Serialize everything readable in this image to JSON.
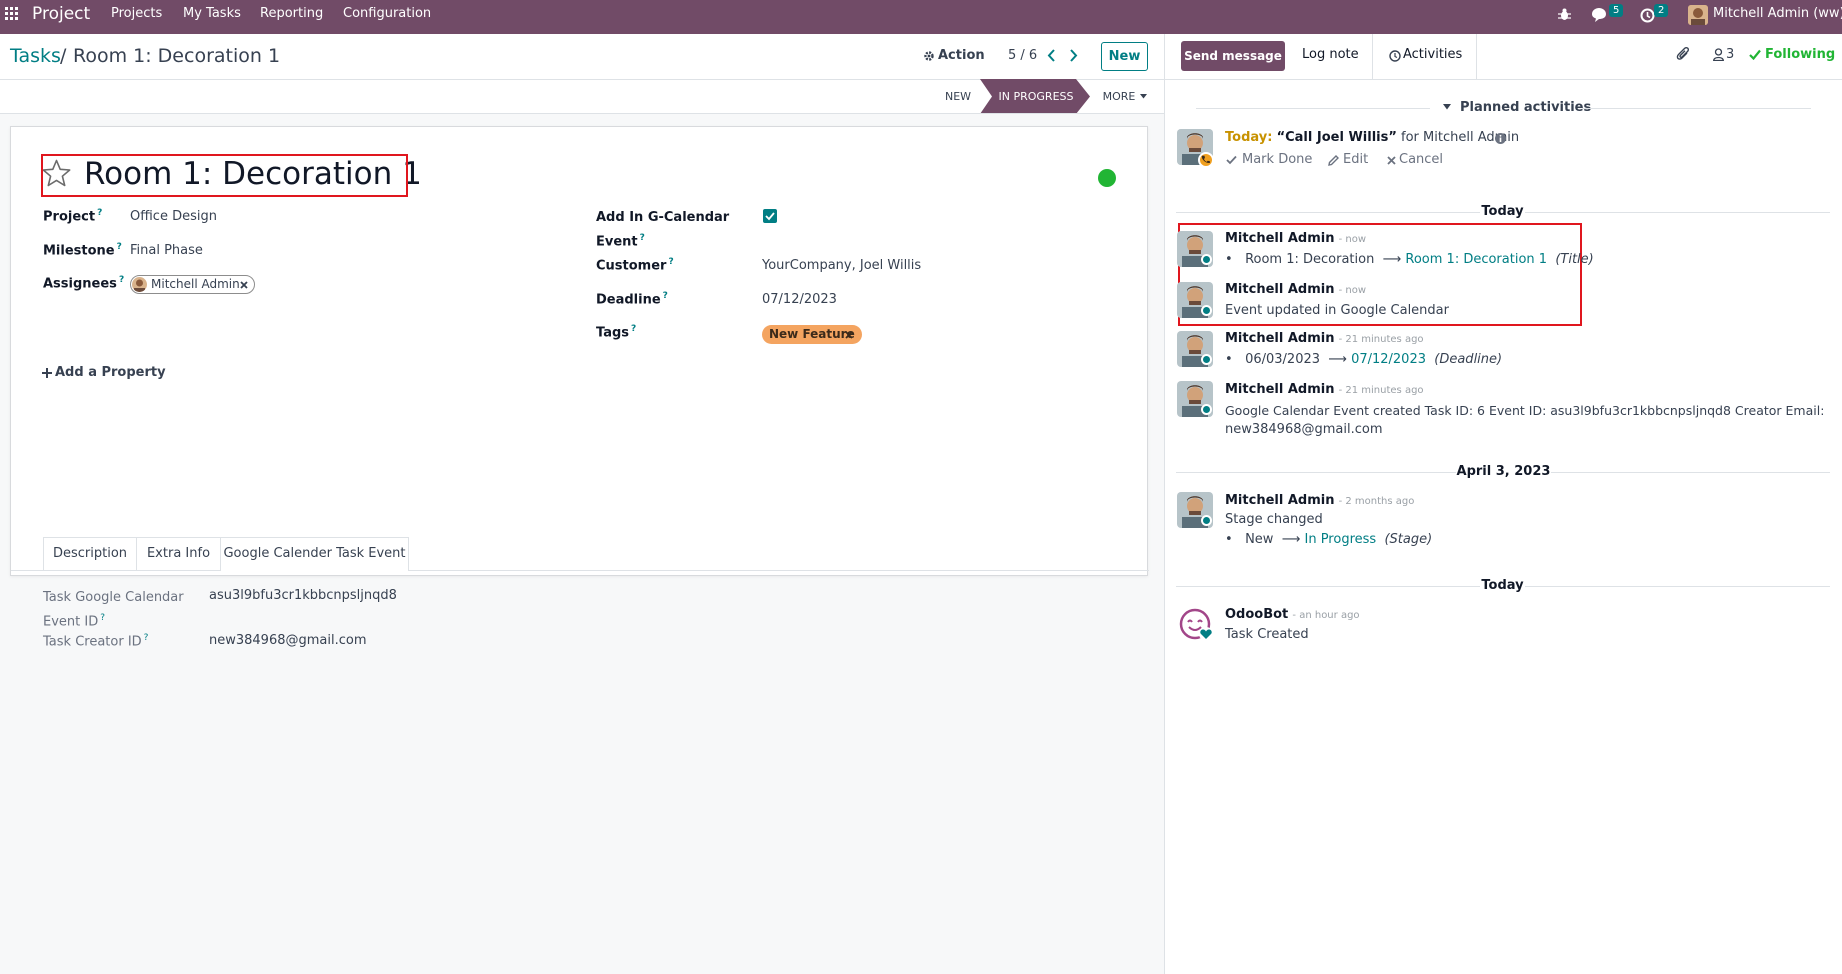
{
  "navbar": {
    "app_name": "Project",
    "menu": [
      "Projects",
      "My Tasks",
      "Reporting",
      "Configuration"
    ],
    "messages_count": "5",
    "activities_count": "2",
    "user_name": "Mitchell Admin (ww)"
  },
  "control": {
    "breadcrumb_parent": "Tasks",
    "breadcrumb_sep": "/",
    "breadcrumb_current": "Room 1: Decoration 1",
    "action_label": "Action",
    "pager": "5 / 6",
    "new_label": "New"
  },
  "statusbar": {
    "stages": [
      "NEW",
      "IN PROGRESS"
    ],
    "active_stage": "IN PROGRESS",
    "more_label": "MORE"
  },
  "form": {
    "title": "Room 1: Decoration 1",
    "kanban_state_color": "#21b534",
    "fields_left": [
      {
        "label": "Project",
        "value": "Office Design"
      },
      {
        "label": "Milestone",
        "value": "Final Phase"
      },
      {
        "label": "Assignees",
        "value": "Mitchell Admin"
      }
    ],
    "fields_right": {
      "gcal_label_1": "Add In G-Calendar",
      "gcal_label_2": "Event",
      "gcal_checked": true,
      "customer_label": "Customer",
      "customer_value": "YourCompany, Joel Willis",
      "deadline_label": "Deadline",
      "deadline_value": "07/12/2023",
      "tags_label": "Tags",
      "tag_value": "New Feature"
    },
    "help_mark": "?",
    "add_property": "Add a Property",
    "tabs": [
      "Description",
      "Extra Info",
      "Google Calender Task Event"
    ],
    "active_tab": "Google Calender Task Event",
    "gcal_fields": {
      "event_label_1": "Task Google Calendar",
      "event_label_2": "Event ID",
      "event_value": "asu3l9bfu3cr1kbbcnpsljnqd8",
      "creator_label": "Task Creator ID",
      "creator_value": "new384968@gmail.com"
    }
  },
  "chatter": {
    "send_message": "Send message",
    "log_note": "Log note",
    "activities": "Activities",
    "followers_count": "3",
    "following": "Following",
    "planned_activities": "Planned activities",
    "activity": {
      "today_label": "Today:",
      "summary": "“Call Joel Willis”",
      "for_text": "for Mitchell Admin",
      "mark_done": "Mark Done",
      "edit": "Edit",
      "cancel": "Cancel"
    },
    "date_today": "Today",
    "date_april": "April 3, 2023",
    "date_today_2": "Today",
    "messages": [
      {
        "author": "Mitchell Admin",
        "time": "- now",
        "old": "Room 1: Decoration",
        "arrow": "⟶",
        "new": "Room 1: Decoration 1",
        "field": "(Title)"
      },
      {
        "author": "Mitchell Admin",
        "time": "- now",
        "body": "Event updated in Google Calendar"
      },
      {
        "author": "Mitchell Admin",
        "time": "- 21 minutes ago",
        "old": "06/03/2023",
        "arrow": "⟶",
        "new": "07/12/2023",
        "field": "(Deadline)"
      },
      {
        "author": "Mitchell Admin",
        "time": "- 21 minutes ago",
        "body": "Google Calendar Event created Task ID: 6 Event ID: asu3l9bfu3cr1kbbcnpsljnqd8 Creator Email:",
        "body2": "new384968@gmail.com"
      },
      {
        "author": "Mitchell Admin",
        "time": "- 2 months ago",
        "body": "Stage changed",
        "old": "New",
        "arrow": "⟶",
        "new": "In Progress",
        "field": "(Stage)"
      },
      {
        "author": "OdooBot",
        "time": "- an hour ago",
        "body": "Task Created"
      }
    ]
  }
}
